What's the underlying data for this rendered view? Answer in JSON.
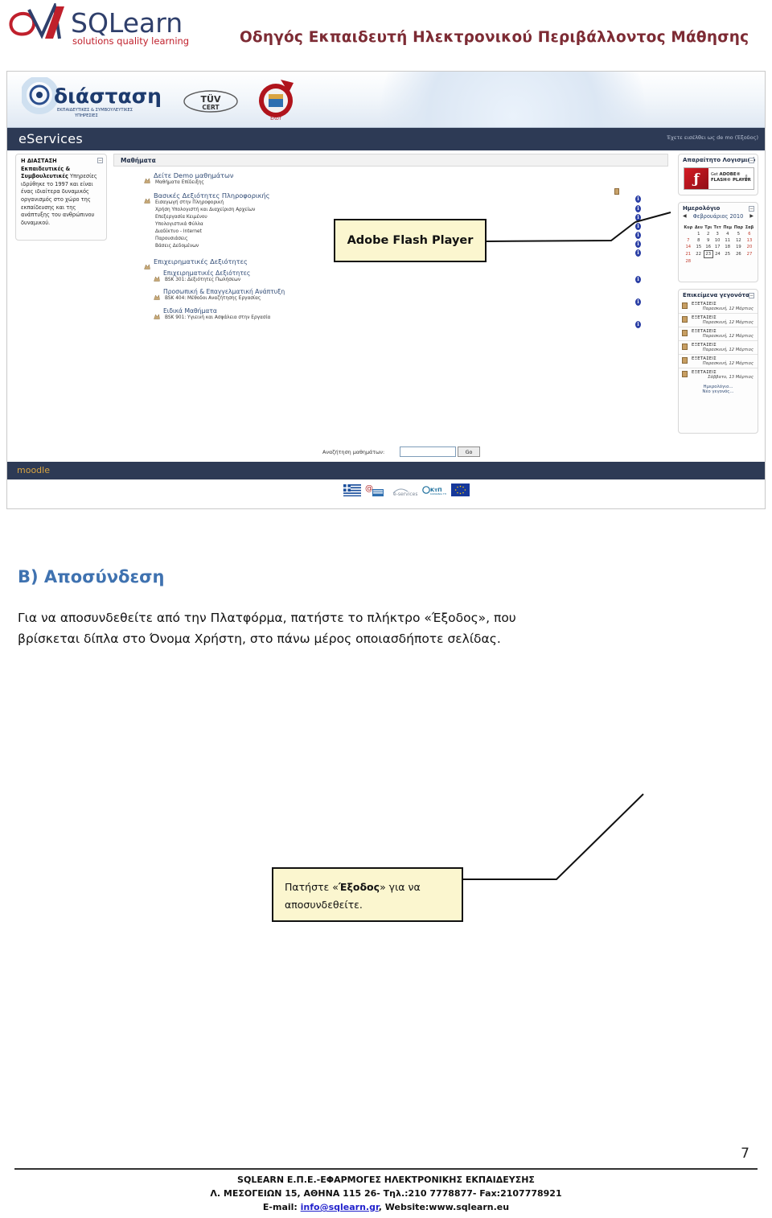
{
  "header": {
    "brand_main": "SQLearn",
    "brand_tag": "solutions quality learning",
    "title": "Οδηγός Εκπαιδευτή Ηλεκτρονικού Περιβάλλοντος Μάθησης",
    "accent_color": "#7d2b34",
    "brand_blue": "#2f3f6b",
    "brand_red": "#c0202c"
  },
  "screenshot": {
    "banner": {
      "logo_word": "διάσταση",
      "logo_sub1": "ΕΚΠΑΙΔΕΥΤΙΚΕΣ & ΣΥΜΒΟΥΛΕΥΤΙΚΕΣ",
      "logo_sub2": "ΥΠΗΡΕΣΙΕΣ",
      "tuv_label": "TÜV",
      "tuv_sub": "CERT",
      "elot_label": "ΕΛΟΤ"
    },
    "nav": {
      "site_name": "eServices",
      "login_status": "Έχετε εισέλθει ως de mo (Έξοδος)",
      "nav_bg": "#2d3a55"
    },
    "left_block": {
      "title": "Η ΔΙΑΣΤΑΣΗ",
      "body_bold_1": "Εκπαιδευτικές &",
      "body_bold_2": "Συμβουλευτικές",
      "body": "Υπηρεσίες ιδρύθηκε το 1997 και είναι ένας ιδιαίτερα δυναμικός οργανισμός στο χώρο της εκπαίδευσης και της ανάπτυξης του ανθρώπινου δυναμικού.",
      "collapse_glyph": "−"
    },
    "courses": {
      "heading": "Μαθήματα",
      "categories": [
        {
          "name": "Δείτε Demo μαθημάτων",
          "level": 1,
          "items": [
            "Μαθήματα Επίδειξης"
          ]
        },
        {
          "name": "Βασικές Δεξιότητες Πληροφορικής",
          "level": 1,
          "items": [
            "Εισαγωγή στην Πληροφορική",
            "Χρήση Υπολογιστή και Διαχείριση Αρχείων",
            "Επεξεργασία Κειμένου",
            "Υπολογιστικά Φύλλα",
            "Διαδίκτυο - Internet",
            "Παρουσιάσεις",
            "Βάσεις Δεδομένων"
          ]
        },
        {
          "name": "Επιχειρηματικές Δεξιότητες",
          "level": 1,
          "items": []
        },
        {
          "name": "Επιχειρηματικές Δεξιότητες",
          "level": 2,
          "items": [
            "BSK 301: Δεξιότητες Πωλήσεων"
          ]
        },
        {
          "name": "Προσωπική & Επαγγελματική Ανάπτυξη",
          "level": 2,
          "items": [
            "BSK 404: Μέθοδοι Αναζήτησης Εργασίας"
          ]
        },
        {
          "name": "Ειδικά Μαθήματα",
          "level": 2,
          "items": [
            "BSK 901: Υγιεινή και Ασφάλεια στην Εργασία"
          ]
        }
      ],
      "search_label": "Αναζήτηση μαθημάτων:",
      "search_value": "",
      "search_placeholder": "",
      "search_button": "Go",
      "info_icon_glyph": "i"
    },
    "flash_panel": {
      "title": "Απαραίτητο Λογισμικό",
      "get_label": "Get",
      "adobe_label": "ADOBE®",
      "product_label": "FLASH® PLAYER",
      "collapse_glyph": "−"
    },
    "calendar": {
      "title": "Ημερολόγιο",
      "prev_glyph": "◀",
      "next_glyph": "▶",
      "month": "Φεβρουάριος 2010",
      "weekdays": [
        "Κυρ",
        "Δευ",
        "Τρι",
        "Τετ",
        "Πεμ",
        "Παρ",
        "Σαβ"
      ],
      "weeks": [
        [
          "",
          "1",
          "2",
          "3",
          "4",
          "5",
          "6"
        ],
        [
          "7",
          "8",
          "9",
          "10",
          "11",
          "12",
          "13"
        ],
        [
          "14",
          "15",
          "16",
          "17",
          "18",
          "19",
          "20"
        ],
        [
          "21",
          "22",
          "23",
          "24",
          "25",
          "26",
          "27"
        ],
        [
          "28",
          "",
          "",
          "",
          "",
          "",
          ""
        ]
      ],
      "today": "23",
      "weekend_indices": [
        0,
        6
      ],
      "collapse_glyph": "−"
    },
    "events": {
      "title": "Επικείμενα γεγονότα",
      "collapse_glyph": "−",
      "rows": [
        {
          "name": "ΕΞΕΤΑΣΕΙΣ",
          "date": "Παρασκευή, 12 Μάρτιος"
        },
        {
          "name": "ΕΞΕΤΑΣΕΙΣ",
          "date": "Παρασκευή, 12 Μάρτιος"
        },
        {
          "name": "ΕΞΕΤΑΣΕΙΣ",
          "date": "Παρασκευή, 12 Μάρτιος"
        },
        {
          "name": "ΕΞΕΤΑΣΕΙΣ",
          "date": "Παρασκευή, 12 Μάρτιος"
        },
        {
          "name": "ΕΞΕΤΑΣΕΙΣ",
          "date": "Παρασκευή, 12 Μάρτιος"
        },
        {
          "name": "ΕΞΕΤΑΣΕΙΣ",
          "date": "Σάββατο, 13 Μάρτιος"
        }
      ],
      "link_calendar": "Ημερολόγιο...",
      "link_new": "Νέο γεγονός..."
    },
    "footer": {
      "moodle": "moodle",
      "flag_names": [
        "greek-flag",
        "espa-logo",
        "eservices-logo",
        "ktp-logo",
        "eu-flag"
      ]
    }
  },
  "callouts": {
    "flash": "Adobe Flash Player",
    "exit_prefix": "Πατήστε «",
    "exit_bold": "Έξοδος",
    "exit_suffix": "» για να",
    "exit_line2": "αποσυνδεθείτε.",
    "box_fill": "#fbf6cf",
    "box_border": "#111111"
  },
  "article": {
    "section_title": "Β) Αποσύνδεση",
    "section_title_color": "#3f72b0",
    "body": "Για να αποσυνδεθείτε από την Πλατφόρμα, πατήστε το πλήκτρο «Έξοδος», που βρίσκεται δίπλα στο Όνομα Χρήστη,  στο πάνω μέρος οποιασδήποτε σελίδας."
  },
  "page_footer": {
    "page_number": "7",
    "line1": "SQLEARN Ε.Π.Ε.-ΕΦΑΡΜΟΓΕΣ ΗΛΕΚΤΡΟΝΙΚΗΣ ΕΚΠΑΙΔΕΥΣΗΣ",
    "line2": "Λ. ΜΕΣΟΓΕΙΩΝ 15, ΑΘΗΝΑ 115 26- Τηλ.:210 7778877- Fax:2107778921",
    "line3_prefix": "E-mail: ",
    "email": "info@sqlearn.gr",
    "line3_suffix": ", Website:www.sqlearn.eu"
  }
}
